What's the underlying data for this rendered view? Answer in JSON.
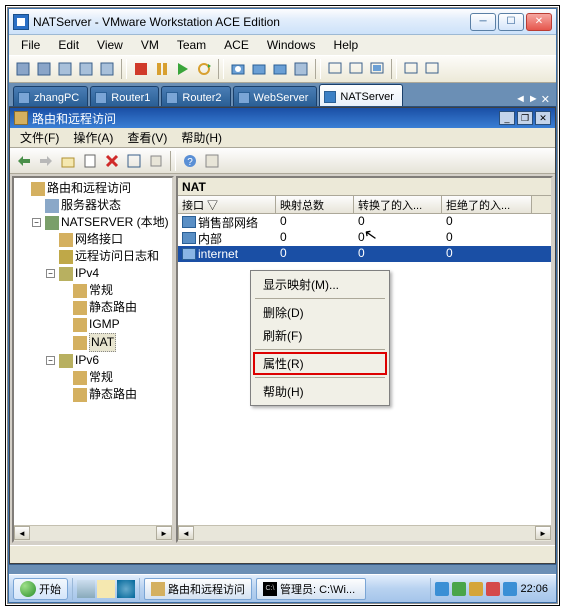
{
  "vmware": {
    "title": "NATServer - VMware Workstation ACE Edition",
    "menu": [
      "File",
      "Edit",
      "View",
      "VM",
      "Team",
      "ACE",
      "Windows",
      "Help"
    ],
    "tabs": [
      {
        "label": "zhangPC",
        "active": false
      },
      {
        "label": "Router1",
        "active": false
      },
      {
        "label": "Router2",
        "active": false
      },
      {
        "label": "WebServer",
        "active": false
      },
      {
        "label": "NATServer",
        "active": true
      }
    ],
    "tabnav": {
      "left": "◄",
      "right": "►",
      "close": "✕"
    }
  },
  "inner": {
    "title": "路由和远程访问",
    "menu": [
      "文件(F)",
      "操作(A)",
      "查看(V)",
      "帮助(H)"
    ]
  },
  "tree": [
    {
      "indent": 0,
      "exp": "",
      "icon": "ico-root",
      "label": "路由和远程访问"
    },
    {
      "indent": 1,
      "exp": "",
      "icon": "ico-server",
      "label": "服务器状态"
    },
    {
      "indent": 1,
      "exp": "-",
      "icon": "ico-comp",
      "label": "NATSERVER (本地)"
    },
    {
      "indent": 2,
      "exp": "",
      "icon": "ico-if",
      "label": "网络接口"
    },
    {
      "indent": 2,
      "exp": "",
      "icon": "ico-log",
      "label": "远程访问日志和"
    },
    {
      "indent": 2,
      "exp": "-",
      "icon": "ico-ipv",
      "label": "IPv4"
    },
    {
      "indent": 3,
      "exp": "",
      "icon": "ico-if",
      "label": "常规"
    },
    {
      "indent": 3,
      "exp": "",
      "icon": "ico-if",
      "label": "静态路由"
    },
    {
      "indent": 3,
      "exp": "",
      "icon": "ico-if",
      "label": "IGMP"
    },
    {
      "indent": 3,
      "exp": "",
      "icon": "ico-if",
      "label": "NAT",
      "sel": true
    },
    {
      "indent": 2,
      "exp": "-",
      "icon": "ico-ipv",
      "label": "IPv6"
    },
    {
      "indent": 3,
      "exp": "",
      "icon": "ico-if",
      "label": "常规"
    },
    {
      "indent": 3,
      "exp": "",
      "icon": "ico-if",
      "label": "静态路由"
    }
  ],
  "pane": {
    "title": "NAT",
    "columns": [
      "接口 ▽",
      "映射总数",
      "转换了的入...",
      "拒绝了的入..."
    ],
    "rows": [
      {
        "name": "销售部网络",
        "v1": "0",
        "v2": "0",
        "v3": "0",
        "sel": false
      },
      {
        "name": "内部",
        "v1": "0",
        "v2": "0",
        "v3": "0",
        "sel": false
      },
      {
        "name": "internet",
        "v1": "0",
        "v2": "0",
        "v3": "0",
        "sel": true
      }
    ]
  },
  "ctx": {
    "items": [
      {
        "label": "显示映射(M)...",
        "type": "item"
      },
      {
        "type": "sep"
      },
      {
        "label": "删除(D)",
        "type": "item"
      },
      {
        "label": "刷新(F)",
        "type": "item"
      },
      {
        "type": "sep"
      },
      {
        "label": "属性(R)",
        "type": "hl"
      },
      {
        "type": "sep"
      },
      {
        "label": "帮助(H)",
        "type": "item"
      }
    ]
  },
  "taskbar": {
    "start": "开始",
    "tasks": [
      {
        "label": "路由和远程访问",
        "color": "#d4b060"
      },
      {
        "label": "管理员: C:\\Wi...",
        "prefix": "C:\\",
        "bg": "#000",
        "fg": "#ccc"
      }
    ],
    "clock": "22:06"
  }
}
